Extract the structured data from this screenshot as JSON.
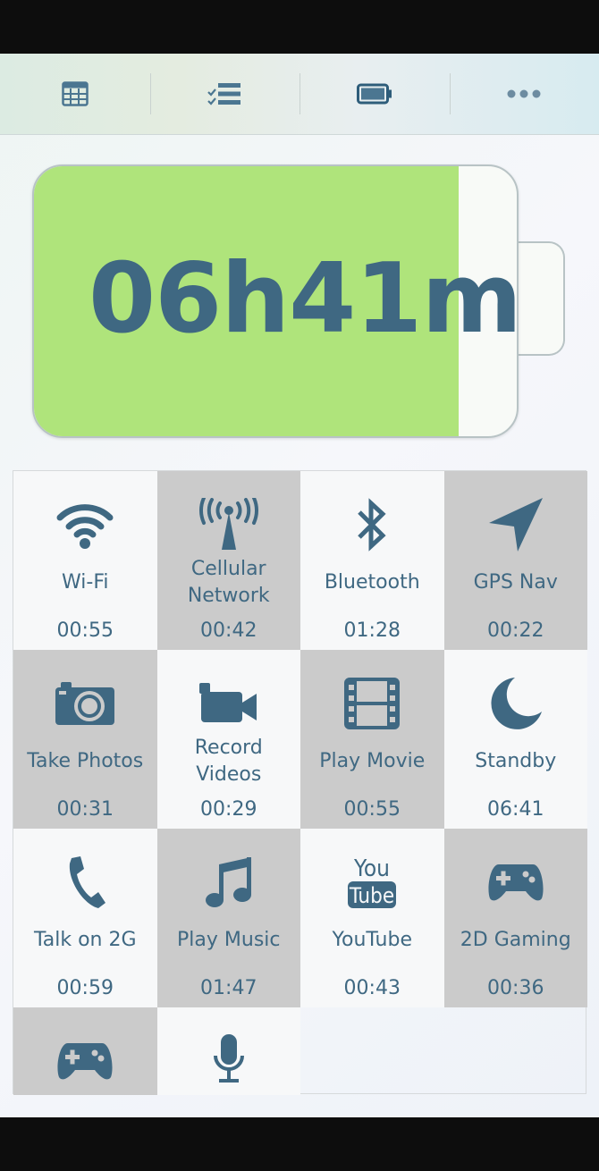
{
  "toolbar": {
    "items": [
      {
        "icon": "table-icon"
      },
      {
        "icon": "checklist-icon"
      },
      {
        "icon": "battery-icon"
      },
      {
        "icon": "more-icon"
      }
    ]
  },
  "battery": {
    "time_remaining": "06h41m",
    "fill_fraction": 0.88,
    "fill_color": "#afe47b"
  },
  "colors": {
    "accent": "#3f6882",
    "tile_light": "#f7f8f9",
    "tile_dark": "#cbcbcb"
  },
  "activities": [
    {
      "label": "Wi-Fi",
      "time": "00:55",
      "icon": "wifi-icon"
    },
    {
      "label": "Cellular Network",
      "time": "00:42",
      "icon": "cellular-tower-icon"
    },
    {
      "label": "Bluetooth",
      "time": "01:28",
      "icon": "bluetooth-icon"
    },
    {
      "label": "GPS Nav",
      "time": "00:22",
      "icon": "navigation-arrow-icon"
    },
    {
      "label": "Take Photos",
      "time": "00:31",
      "icon": "camera-icon"
    },
    {
      "label": "Record Videos",
      "time": "00:29",
      "icon": "video-camera-icon"
    },
    {
      "label": "Play Movie",
      "time": "00:55",
      "icon": "film-icon"
    },
    {
      "label": "Standby",
      "time": "06:41",
      "icon": "moon-icon"
    },
    {
      "label": "Talk on 2G",
      "time": "00:59",
      "icon": "phone-icon"
    },
    {
      "label": "Play Music",
      "time": "01:47",
      "icon": "music-note-icon"
    },
    {
      "label": "YouTube",
      "time": "00:43",
      "icon": "youtube-icon",
      "logo_text_top": "You",
      "logo_text_bottom": "Tube"
    },
    {
      "label": "2D Gaming",
      "time": "00:36",
      "icon": "gamepad-icon"
    },
    {
      "label": "",
      "time": "",
      "icon": "gamepad-icon"
    },
    {
      "label": "",
      "time": "",
      "icon": "microphone-icon"
    }
  ]
}
